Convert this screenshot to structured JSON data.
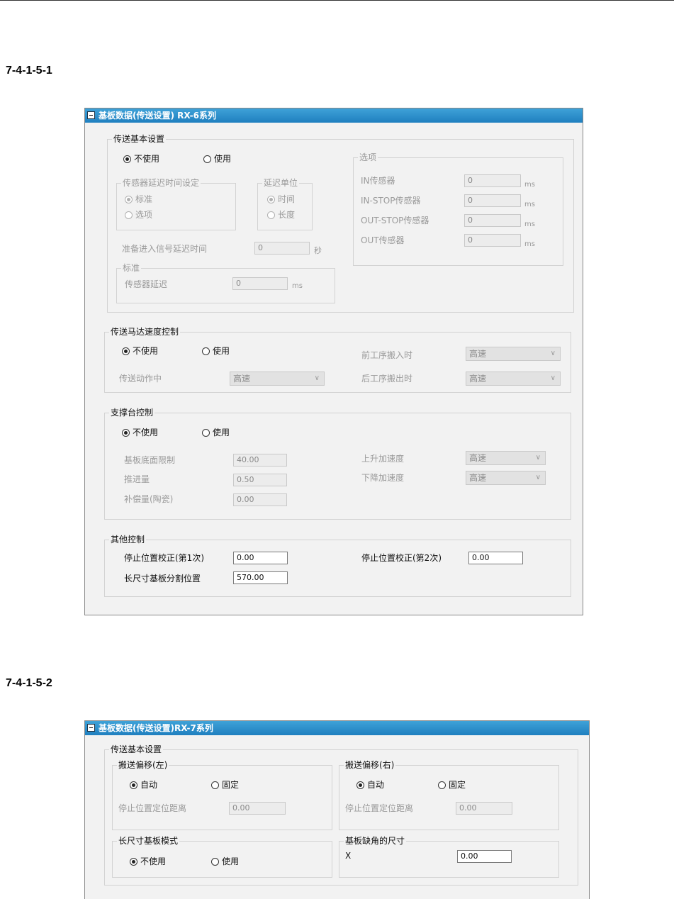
{
  "sections": [
    "7-4-1-5-1",
    "7-4-1-5-2"
  ],
  "panel1": {
    "title": "基板数据(传送设置) RX-6系列",
    "basic": {
      "legend": "传送基本设置",
      "radio_off": "不使用",
      "radio_on": "使用",
      "sensor_delay": {
        "legend": "传感器延迟时间设定",
        "opt1": "标准",
        "opt2": "选项"
      },
      "delay_unit": {
        "legend": "延迟单位",
        "opt1": "时间",
        "opt2": "长度"
      },
      "ready_delay": {
        "label": "准备进入信号延迟时间",
        "value": "0",
        "unit": "秒"
      },
      "standard": {
        "legend": "标准",
        "label": "传感器延迟",
        "value": "0",
        "unit": "ms"
      },
      "options": {
        "legend": "选项",
        "rows": [
          {
            "label": "IN传感器",
            "value": "0",
            "unit": "ms"
          },
          {
            "label": "IN-STOP传感器",
            "value": "0",
            "unit": "ms"
          },
          {
            "label": "OUT-STOP传感器",
            "value": "0",
            "unit": "ms"
          },
          {
            "label": "OUT传感器",
            "value": "0",
            "unit": "ms"
          }
        ]
      }
    },
    "motor": {
      "legend": "传送马达速度控制",
      "radio_off": "不使用",
      "radio_on": "使用",
      "during_label": "传送动作中",
      "during_value": "高速",
      "prev_in_label": "前工序搬入时",
      "prev_in_value": "高速",
      "next_out_label": "后工序搬出时",
      "next_out_value": "高速"
    },
    "support": {
      "legend": "支撑台控制",
      "radio_off": "不使用",
      "radio_on": "使用",
      "bottom_label": "基板底面限制",
      "bottom_value": "40.00",
      "push_label": "推进量",
      "push_value": "0.50",
      "comp_label": "补偿量(陶瓷)",
      "comp_value": "0.00",
      "up_label": "上升加速度",
      "up_value": "高速",
      "down_label": "下降加速度",
      "down_value": "高速"
    },
    "other": {
      "legend": "其他控制",
      "stop1_label": "停止位置校正(第1次)",
      "stop1_value": "0.00",
      "stop2_label": "停止位置校正(第2次)",
      "stop2_value": "0.00",
      "split_label": "长尺寸基板分割位置",
      "split_value": "570.00"
    }
  },
  "panel2": {
    "title": "基板数据(传送设置)RX-7系列",
    "basic": {
      "legend": "传送基本设置",
      "left": {
        "legend": "搬送偏移(左)",
        "radio_auto": "自动",
        "radio_fixed": "固定",
        "dist_label": "停止位置定位距离",
        "dist_value": "0.00"
      },
      "right": {
        "legend": "搬送偏移(右)",
        "radio_auto": "自动",
        "radio_fixed": "固定",
        "dist_label": "停止位置定位距离",
        "dist_value": "0.00"
      },
      "long_mode": {
        "legend": "长尺寸基板模式",
        "radio_off": "不使用",
        "radio_on": "使用"
      },
      "corner": {
        "legend": "基板缺角的尺寸",
        "x_label": "X",
        "x_value": "0.00"
      }
    }
  }
}
